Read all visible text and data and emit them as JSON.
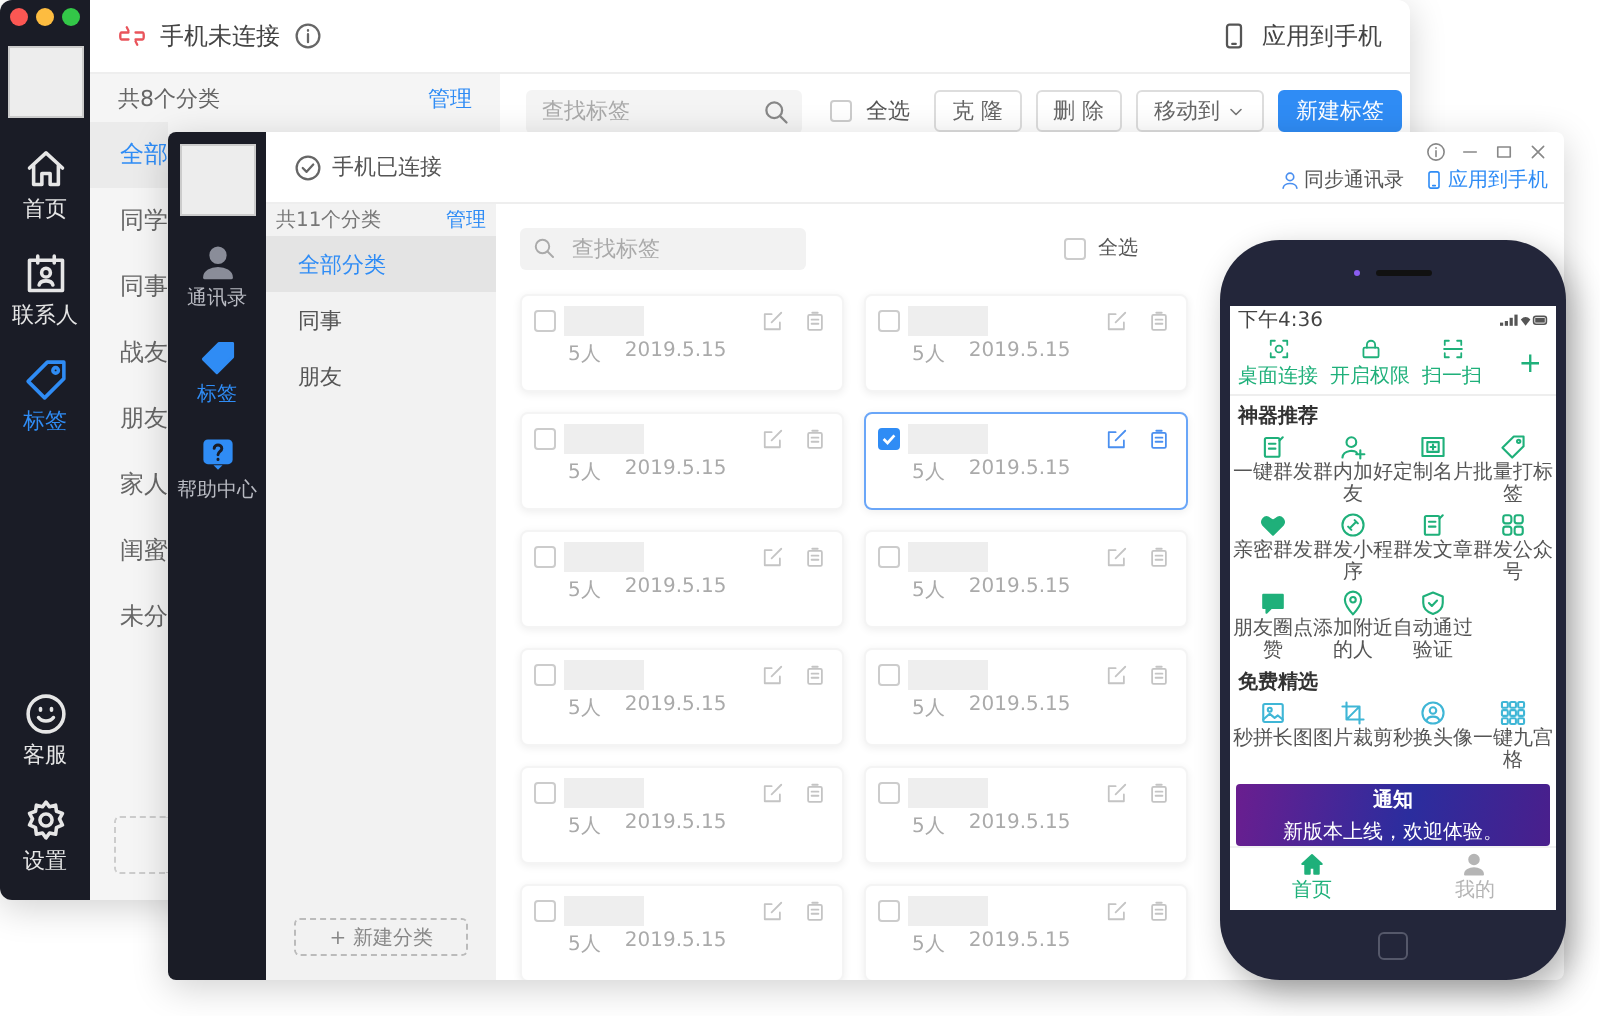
{
  "back_window": {
    "rail": {
      "items": [
        {
          "label": "首页",
          "selected": false
        },
        {
          "label": "联系人",
          "selected": false
        },
        {
          "label": "标签",
          "selected": true
        }
      ],
      "bottom_items": [
        {
          "label": "客服"
        },
        {
          "label": "设置"
        }
      ]
    },
    "status": "手机未连接",
    "apply_link": "应用到手机",
    "categories": {
      "count": "共8个分类",
      "manage": "管理",
      "items": [
        {
          "label": "全部",
          "selected": true
        },
        {
          "label": "同学",
          "selected": false
        },
        {
          "label": "同事",
          "selected": false
        },
        {
          "label": "战友",
          "selected": false
        },
        {
          "label": "朋友",
          "selected": false
        },
        {
          "label": "家人",
          "selected": false
        },
        {
          "label": "闺蜜",
          "selected": false
        },
        {
          "label": "未分",
          "selected": false
        }
      ]
    },
    "toolbar": {
      "search_placeholder": "查找标签",
      "select_all": {
        "label": "全选",
        "checked": false
      },
      "buttons": [
        {
          "label": "克 隆",
          "kind": "plain"
        },
        {
          "label": "删 除",
          "kind": "plain"
        },
        {
          "label": "移动到",
          "kind": "dropdown"
        },
        {
          "label": "新建标签",
          "kind": "primary"
        }
      ]
    }
  },
  "front_window": {
    "rail": {
      "items": [
        {
          "label": "通讯录",
          "selected": false
        },
        {
          "label": "标签",
          "selected": true
        },
        {
          "label": "帮助中心",
          "selected": false
        }
      ]
    },
    "status": "手机已连接",
    "sync_link": "同步通讯录",
    "apply_link": "应用到手机",
    "categories": {
      "count": "共11个分类",
      "manage": "管理",
      "items": [
        {
          "label": "全部分类",
          "selected": true
        },
        {
          "label": "同事",
          "selected": false
        },
        {
          "label": "朋友",
          "selected": false
        }
      ],
      "new_button": "+ 新建分类"
    },
    "toolbar": {
      "search_placeholder": "查找标签",
      "select_all": {
        "label": "全选",
        "checked": false
      }
    },
    "cards": [
      {
        "count": "5人",
        "date": "2019.5.15",
        "checked": false
      },
      {
        "count": "5人",
        "date": "2019.5.15",
        "checked": false
      },
      {
        "count": "5人",
        "date": "2019.5.15",
        "checked": false
      },
      {
        "count": "5人",
        "date": "2019.5.15",
        "checked": true
      },
      {
        "count": "5人",
        "date": "2019.5.15",
        "checked": false
      },
      {
        "count": "5人",
        "date": "2019.5.15",
        "checked": false
      },
      {
        "count": "5人",
        "date": "2019.5.15",
        "checked": false
      },
      {
        "count": "5人",
        "date": "2019.5.15",
        "checked": false
      },
      {
        "count": "5人",
        "date": "2019.5.15",
        "checked": false
      },
      {
        "count": "5人",
        "date": "2019.5.15",
        "checked": false
      },
      {
        "count": "5人",
        "date": "2019.5.15",
        "checked": false
      },
      {
        "count": "5人",
        "date": "2019.5.15",
        "checked": false
      }
    ]
  },
  "phone": {
    "time": "下午4:36",
    "quick_actions": [
      "桌面连接",
      "开启权限",
      "扫一扫"
    ],
    "add": "+",
    "sections": [
      {
        "title": "神器推荐",
        "tools": [
          "一键群发",
          "群内加好友",
          "定制名片",
          "批量打标签",
          "亲密群发",
          "群发小程序",
          "群发文章",
          "群发公众号",
          "朋友圈点赞",
          "添加附近的人",
          "自动通过验证"
        ]
      },
      {
        "title": "免费精选",
        "tools": [
          "秒拼长图",
          "图片裁剪",
          "秒换头像",
          "一键九宫格"
        ]
      }
    ],
    "banner": {
      "title": "通知",
      "text": "新版本上线，欢迎体验。"
    },
    "tabs": [
      {
        "label": "首页",
        "selected": true
      },
      {
        "label": "我的",
        "selected": false
      }
    ]
  }
}
